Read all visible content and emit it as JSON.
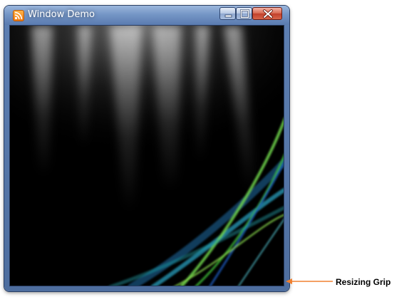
{
  "window": {
    "title": "Window Demo",
    "icon": "rss-feed-icon",
    "controls": {
      "minimize": "minimize-icon",
      "maximize": "maximize-icon",
      "close": "close-icon"
    },
    "client_content": "vista-aurora-wallpaper"
  },
  "annotation": {
    "label": "Resizing Grip",
    "color": "#f08030"
  }
}
